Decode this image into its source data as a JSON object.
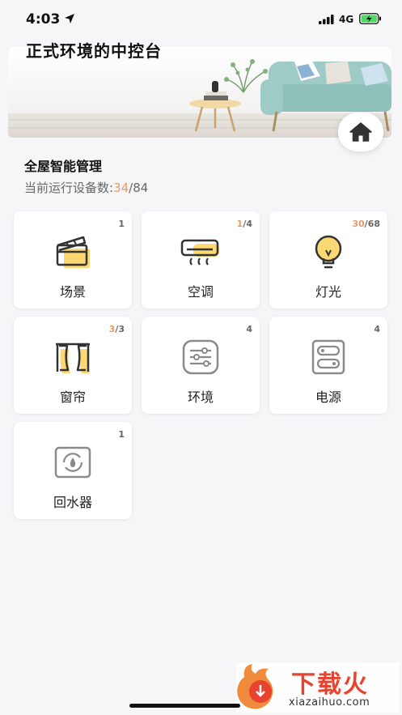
{
  "status_bar": {
    "time": "4:03",
    "network": "4G"
  },
  "header": {
    "title": "正式环境的中控台"
  },
  "section": {
    "title": "全屋智能管理",
    "count_label": "当前运行设备数:",
    "active_count": "34",
    "separator": "/",
    "total_count": "84"
  },
  "devices": [
    {
      "label": "场景",
      "on": "",
      "total": "1"
    },
    {
      "label": "空调",
      "on": "1",
      "total": "/4"
    },
    {
      "label": "灯光",
      "on": "30",
      "total": "/68"
    },
    {
      "label": "窗帘",
      "on": "3",
      "total": "/3"
    },
    {
      "label": "环境",
      "on": "",
      "total": "4"
    },
    {
      "label": "电源",
      "on": "",
      "total": "4"
    },
    {
      "label": "回水器",
      "on": "",
      "total": "1"
    }
  ],
  "watermark": {
    "brand": "下载火",
    "url": "xiazaihuo.com"
  },
  "colors": {
    "accent": "#e89a66",
    "icon_yellow": "#fcd873",
    "icon_gray": "#8a8a8a"
  }
}
